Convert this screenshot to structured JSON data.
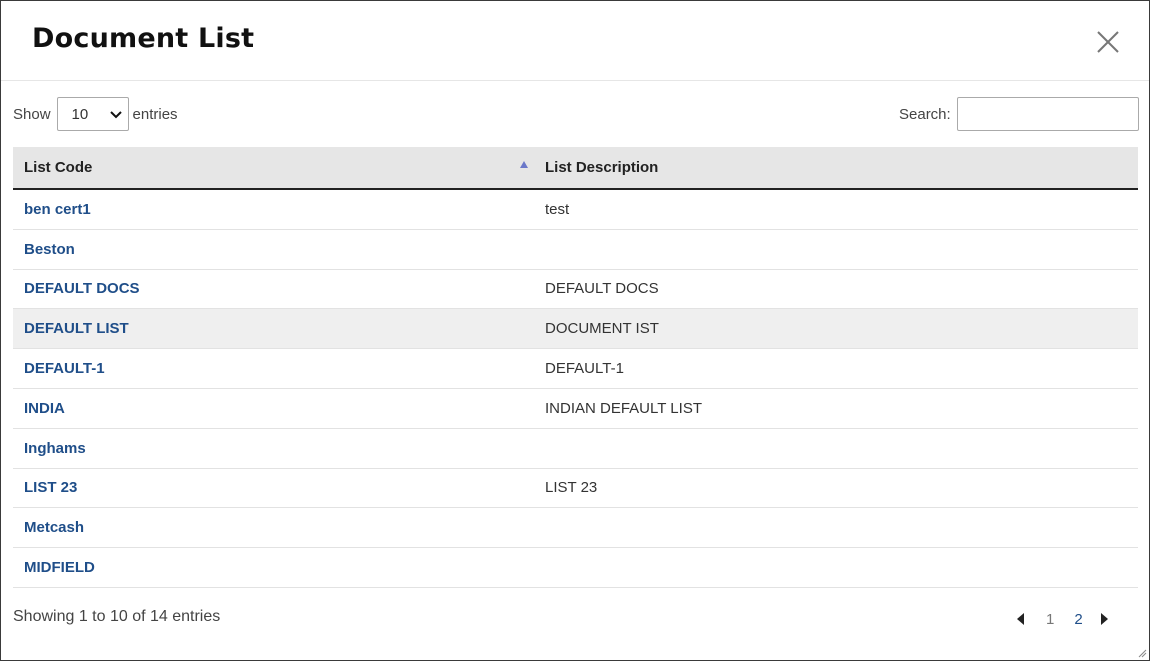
{
  "dialog": {
    "title": "Document List",
    "close_icon": "close-icon"
  },
  "length_control": {
    "show_label": "Show",
    "selected": "10",
    "entries_label": "entries"
  },
  "search": {
    "label": "Search:",
    "value": ""
  },
  "table": {
    "columns": [
      "List Code",
      "List Description"
    ],
    "sort": {
      "column": "List Code",
      "direction": "ascending"
    },
    "rows": [
      {
        "code": "ben cert1",
        "description": "test"
      },
      {
        "code": "Beston",
        "description": ""
      },
      {
        "code": "DEFAULT DOCS",
        "description": "DEFAULT DOCS"
      },
      {
        "code": "DEFAULT LIST",
        "description": "DOCUMENT IST",
        "highlighted": true
      },
      {
        "code": "DEFAULT-1",
        "description": "DEFAULT-1"
      },
      {
        "code": "INDIA",
        "description": "INDIAN DEFAULT LIST"
      },
      {
        "code": "Inghams",
        "description": ""
      },
      {
        "code": "LIST 23",
        "description": "LIST 23"
      },
      {
        "code": "Metcash",
        "description": ""
      },
      {
        "code": "MIDFIELD",
        "description": ""
      }
    ]
  },
  "footer": {
    "info": "Showing 1 to 10 of 14 entries",
    "pages": [
      "1",
      "2"
    ],
    "current_page": "2"
  },
  "colors": {
    "link": "#1f4e89",
    "header_bg": "#e6e6e6",
    "sort_active": "#6b78c9",
    "row_highlight": "#efefef"
  }
}
